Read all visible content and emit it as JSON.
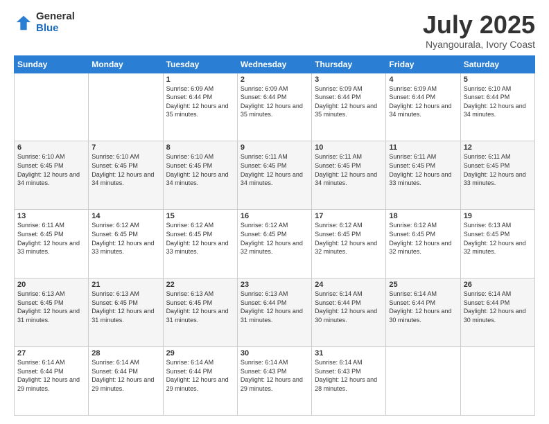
{
  "logo": {
    "general": "General",
    "blue": "Blue"
  },
  "title": "July 2025",
  "subtitle": "Nyangourala, Ivory Coast",
  "days_header": [
    "Sunday",
    "Monday",
    "Tuesday",
    "Wednesday",
    "Thursday",
    "Friday",
    "Saturday"
  ],
  "weeks": [
    [
      {
        "day": "",
        "sunrise": "",
        "sunset": "",
        "daylight": ""
      },
      {
        "day": "",
        "sunrise": "",
        "sunset": "",
        "daylight": ""
      },
      {
        "day": "1",
        "sunrise": "Sunrise: 6:09 AM",
        "sunset": "Sunset: 6:44 PM",
        "daylight": "Daylight: 12 hours and 35 minutes."
      },
      {
        "day": "2",
        "sunrise": "Sunrise: 6:09 AM",
        "sunset": "Sunset: 6:44 PM",
        "daylight": "Daylight: 12 hours and 35 minutes."
      },
      {
        "day": "3",
        "sunrise": "Sunrise: 6:09 AM",
        "sunset": "Sunset: 6:44 PM",
        "daylight": "Daylight: 12 hours and 35 minutes."
      },
      {
        "day": "4",
        "sunrise": "Sunrise: 6:09 AM",
        "sunset": "Sunset: 6:44 PM",
        "daylight": "Daylight: 12 hours and 34 minutes."
      },
      {
        "day": "5",
        "sunrise": "Sunrise: 6:10 AM",
        "sunset": "Sunset: 6:44 PM",
        "daylight": "Daylight: 12 hours and 34 minutes."
      }
    ],
    [
      {
        "day": "6",
        "sunrise": "Sunrise: 6:10 AM",
        "sunset": "Sunset: 6:45 PM",
        "daylight": "Daylight: 12 hours and 34 minutes."
      },
      {
        "day": "7",
        "sunrise": "Sunrise: 6:10 AM",
        "sunset": "Sunset: 6:45 PM",
        "daylight": "Daylight: 12 hours and 34 minutes."
      },
      {
        "day": "8",
        "sunrise": "Sunrise: 6:10 AM",
        "sunset": "Sunset: 6:45 PM",
        "daylight": "Daylight: 12 hours and 34 minutes."
      },
      {
        "day": "9",
        "sunrise": "Sunrise: 6:11 AM",
        "sunset": "Sunset: 6:45 PM",
        "daylight": "Daylight: 12 hours and 34 minutes."
      },
      {
        "day": "10",
        "sunrise": "Sunrise: 6:11 AM",
        "sunset": "Sunset: 6:45 PM",
        "daylight": "Daylight: 12 hours and 34 minutes."
      },
      {
        "day": "11",
        "sunrise": "Sunrise: 6:11 AM",
        "sunset": "Sunset: 6:45 PM",
        "daylight": "Daylight: 12 hours and 33 minutes."
      },
      {
        "day": "12",
        "sunrise": "Sunrise: 6:11 AM",
        "sunset": "Sunset: 6:45 PM",
        "daylight": "Daylight: 12 hours and 33 minutes."
      }
    ],
    [
      {
        "day": "13",
        "sunrise": "Sunrise: 6:11 AM",
        "sunset": "Sunset: 6:45 PM",
        "daylight": "Daylight: 12 hours and 33 minutes."
      },
      {
        "day": "14",
        "sunrise": "Sunrise: 6:12 AM",
        "sunset": "Sunset: 6:45 PM",
        "daylight": "Daylight: 12 hours and 33 minutes."
      },
      {
        "day": "15",
        "sunrise": "Sunrise: 6:12 AM",
        "sunset": "Sunset: 6:45 PM",
        "daylight": "Daylight: 12 hours and 33 minutes."
      },
      {
        "day": "16",
        "sunrise": "Sunrise: 6:12 AM",
        "sunset": "Sunset: 6:45 PM",
        "daylight": "Daylight: 12 hours and 32 minutes."
      },
      {
        "day": "17",
        "sunrise": "Sunrise: 6:12 AM",
        "sunset": "Sunset: 6:45 PM",
        "daylight": "Daylight: 12 hours and 32 minutes."
      },
      {
        "day": "18",
        "sunrise": "Sunrise: 6:12 AM",
        "sunset": "Sunset: 6:45 PM",
        "daylight": "Daylight: 12 hours and 32 minutes."
      },
      {
        "day": "19",
        "sunrise": "Sunrise: 6:13 AM",
        "sunset": "Sunset: 6:45 PM",
        "daylight": "Daylight: 12 hours and 32 minutes."
      }
    ],
    [
      {
        "day": "20",
        "sunrise": "Sunrise: 6:13 AM",
        "sunset": "Sunset: 6:45 PM",
        "daylight": "Daylight: 12 hours and 31 minutes."
      },
      {
        "day": "21",
        "sunrise": "Sunrise: 6:13 AM",
        "sunset": "Sunset: 6:45 PM",
        "daylight": "Daylight: 12 hours and 31 minutes."
      },
      {
        "day": "22",
        "sunrise": "Sunrise: 6:13 AM",
        "sunset": "Sunset: 6:45 PM",
        "daylight": "Daylight: 12 hours and 31 minutes."
      },
      {
        "day": "23",
        "sunrise": "Sunrise: 6:13 AM",
        "sunset": "Sunset: 6:44 PM",
        "daylight": "Daylight: 12 hours and 31 minutes."
      },
      {
        "day": "24",
        "sunrise": "Sunrise: 6:14 AM",
        "sunset": "Sunset: 6:44 PM",
        "daylight": "Daylight: 12 hours and 30 minutes."
      },
      {
        "day": "25",
        "sunrise": "Sunrise: 6:14 AM",
        "sunset": "Sunset: 6:44 PM",
        "daylight": "Daylight: 12 hours and 30 minutes."
      },
      {
        "day": "26",
        "sunrise": "Sunrise: 6:14 AM",
        "sunset": "Sunset: 6:44 PM",
        "daylight": "Daylight: 12 hours and 30 minutes."
      }
    ],
    [
      {
        "day": "27",
        "sunrise": "Sunrise: 6:14 AM",
        "sunset": "Sunset: 6:44 PM",
        "daylight": "Daylight: 12 hours and 29 minutes."
      },
      {
        "day": "28",
        "sunrise": "Sunrise: 6:14 AM",
        "sunset": "Sunset: 6:44 PM",
        "daylight": "Daylight: 12 hours and 29 minutes."
      },
      {
        "day": "29",
        "sunrise": "Sunrise: 6:14 AM",
        "sunset": "Sunset: 6:44 PM",
        "daylight": "Daylight: 12 hours and 29 minutes."
      },
      {
        "day": "30",
        "sunrise": "Sunrise: 6:14 AM",
        "sunset": "Sunset: 6:43 PM",
        "daylight": "Daylight: 12 hours and 29 minutes."
      },
      {
        "day": "31",
        "sunrise": "Sunrise: 6:14 AM",
        "sunset": "Sunset: 6:43 PM",
        "daylight": "Daylight: 12 hours and 28 minutes."
      },
      {
        "day": "",
        "sunrise": "",
        "sunset": "",
        "daylight": ""
      },
      {
        "day": "",
        "sunrise": "",
        "sunset": "",
        "daylight": ""
      }
    ]
  ]
}
